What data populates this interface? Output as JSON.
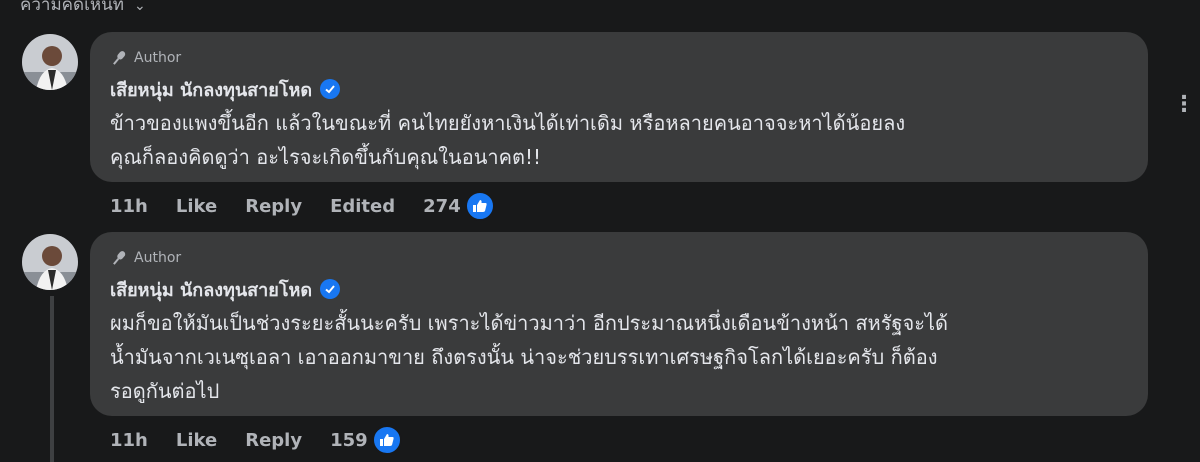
{
  "header": {
    "cut_text": "ความคิดเห็นที่",
    "cut_chevron": "⌄"
  },
  "comments": [
    {
      "author_badge": "Author",
      "name": "เสียหนุ่ม นักลงทุนสายโหด",
      "lines": [
        "ข้าวของแพงขึ้นอีก แล้วในขณะที่ คนไทยยังหาเงินได้เท่าเดิม หรือหลายคนอาจจะหาได้น้อยลง",
        "คุณก็ลองคิดดูว่า อะไรจะเกิดขึ้นกับคุณในอนาคต!!"
      ],
      "time": "11h",
      "like_label": "Like",
      "reply_label": "Reply",
      "edited_label": "Edited",
      "reaction_count": "274"
    },
    {
      "author_badge": "Author",
      "name": "เสียหนุ่ม นักลงทุนสายโหด",
      "lines": [
        "ผมก็ขอให้มันเป็นช่วงระยะสั้นนะครับ เพราะได้ข่าวมาว่า อีกประมาณหนึ่งเดือนข้างหน้า สหรัฐจะได้",
        "น้ำมันจากเวเนซุเอลา เอาออกมาขาย ถึงตรงนั้น น่าจะช่วยบรรเทาเศรษฐกิจโลกได้เยอะครับ ก็ต้อง",
        "รอดูกันต่อไป"
      ],
      "time": "11h",
      "like_label": "Like",
      "reply_label": "Reply",
      "reaction_count": "159"
    }
  ],
  "more_icon": "⋮",
  "colors": {
    "background": "#18191a",
    "bubble": "#3a3b3c",
    "accent": "#1877f2",
    "muted": "#b0b3b8"
  }
}
